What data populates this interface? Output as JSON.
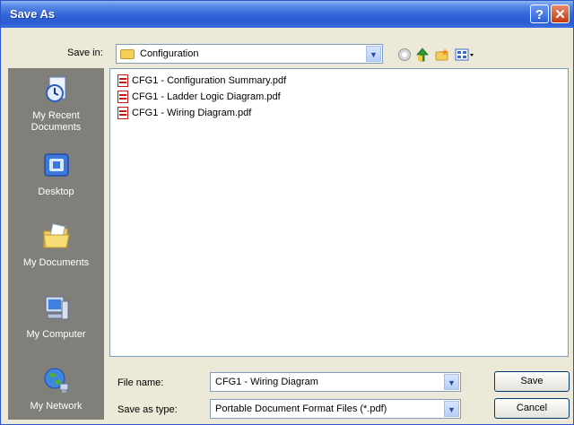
{
  "window": {
    "title": "Save As"
  },
  "titlebar": {
    "help_glyph": "?",
    "close_glyph": "✕"
  },
  "save_in": {
    "label": "Save in:",
    "value": "Configuration"
  },
  "toolbar_icons": [
    "back-icon",
    "up-folder-icon",
    "new-folder-icon",
    "views-menu-icon"
  ],
  "places": [
    {
      "name": "recent",
      "label_line1": "My Recent",
      "label_line2": "Documents",
      "icon": "recent-documents-icon"
    },
    {
      "name": "desktop",
      "label_line1": "Desktop",
      "label_line2": "",
      "icon": "desktop-icon"
    },
    {
      "name": "documents",
      "label_line1": "My Documents",
      "label_line2": "",
      "icon": "my-documents-icon"
    },
    {
      "name": "computer",
      "label_line1": "My Computer",
      "label_line2": "",
      "icon": "my-computer-icon"
    },
    {
      "name": "network",
      "label_line1": "My Network",
      "label_line2": "",
      "icon": "my-network-icon"
    }
  ],
  "files": [
    {
      "name": "CFG1 - Configuration Summary.pdf",
      "icon": "pdf-file-icon"
    },
    {
      "name": "CFG1 - Ladder Logic Diagram.pdf",
      "icon": "pdf-file-icon"
    },
    {
      "name": "CFG1 - Wiring Diagram.pdf",
      "icon": "pdf-file-icon"
    }
  ],
  "file_name": {
    "label": "File name:",
    "value": "CFG1 - Wiring Diagram"
  },
  "save_as_type": {
    "label": "Save as type:",
    "value": "Portable Document Format Files (*.pdf)"
  },
  "buttons": {
    "save": "Save",
    "cancel": "Cancel"
  },
  "colors": {
    "title_bar": "#2f63d6",
    "places_bar": "#807f7a",
    "dialog_bg": "#ece9d8",
    "pdf_red": "#c01818"
  }
}
